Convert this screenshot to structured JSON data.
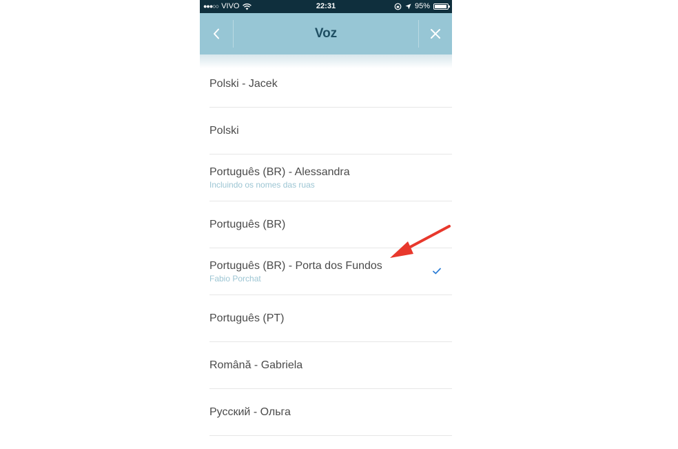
{
  "status_bar": {
    "signal_dots": "●●●○○",
    "carrier": "VIVO",
    "time": "22:31",
    "battery_percent": "95%",
    "battery_level": 0.95
  },
  "nav": {
    "title": "Voz",
    "back_icon": "chevron-left-icon",
    "close_icon": "close-icon"
  },
  "voices": [
    {
      "title": "Polski - Jacek",
      "subtitle": "",
      "selected": false
    },
    {
      "title": "Polski",
      "subtitle": "",
      "selected": false
    },
    {
      "title": "Português (BR) - Alessandra",
      "subtitle": "Incluindo os nomes das ruas",
      "selected": false
    },
    {
      "title": "Português (BR)",
      "subtitle": "",
      "selected": false
    },
    {
      "title": "Português (BR) - Porta dos Fundos",
      "subtitle": "Fabio Porchat",
      "selected": true
    },
    {
      "title": "Português (PT)",
      "subtitle": "",
      "selected": false
    },
    {
      "title": "Română - Gabriela",
      "subtitle": "",
      "selected": false
    },
    {
      "title": "Русский - Ольга",
      "subtitle": "",
      "selected": false
    }
  ],
  "colors": {
    "nav_background": "#97c6d5",
    "status_background": "#0f2f3d",
    "check": "#2f7fd6",
    "annotation_arrow": "#e8382c"
  }
}
